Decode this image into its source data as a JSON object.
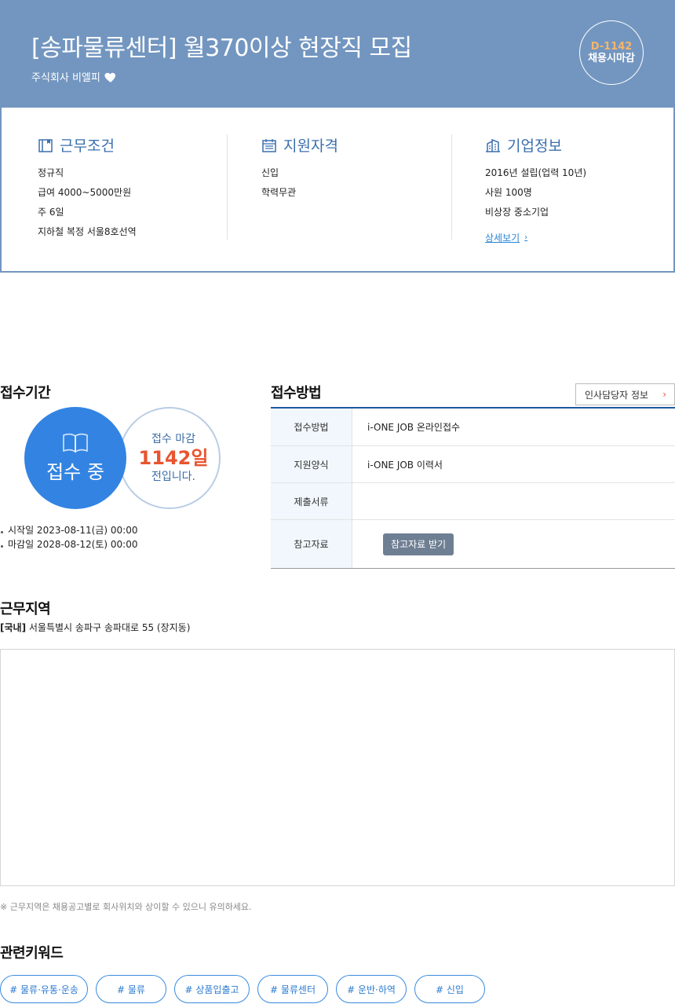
{
  "header": {
    "title": "[송파물류센터] 월370이상 현장직 모집",
    "company": "주식회사 비엘피",
    "dday": "D-1142",
    "deadline_text": "채용시마감"
  },
  "summary": {
    "work": {
      "title": "근무조건",
      "items": [
        "정규직",
        "급여 4000~5000만원",
        "주 6일",
        "지하철 복정 서울8호선역"
      ]
    },
    "qualification": {
      "title": "지원자격",
      "items": [
        "신입",
        "학력무관"
      ]
    },
    "company": {
      "title": "기업정보",
      "items": [
        "2016년 설립(업력 10년)",
        "사원 100명",
        "비상장 중소기업"
      ],
      "more": "상세보기"
    }
  },
  "period": {
    "title": "접수기간",
    "status": "접수 중",
    "deadline_label": "접수 마감",
    "days": "1142일",
    "suffix": "전입니다.",
    "start": "시작일 2023-08-11(금) 00:00",
    "end": "마감일 2028-08-12(토) 00:00"
  },
  "method": {
    "title": "접수방법",
    "contact_button": "인사담당자 정보",
    "rows": [
      {
        "label": "접수방법",
        "value": "i-ONE JOB 온라인접수"
      },
      {
        "label": "지원양식",
        "value": "i-ONE JOB 이력서"
      },
      {
        "label": "제출서류",
        "value": ""
      },
      {
        "label": "참고자료",
        "value": ""
      }
    ],
    "ref_button": "참고자료 받기"
  },
  "location": {
    "title": "근무지역",
    "region": "[국내]",
    "address": "서울특별시 송파구 송파대로 55 (장지동)",
    "note": "※ 근무지역은 채용공고별로 회사위치와 상이할 수 있으니 유의하세요."
  },
  "keywords": {
    "title": "관련키워드",
    "items": [
      "# 물류·유통·운송",
      "# 물류",
      "# 상품입출고",
      "# 물류센터",
      "# 운반·하역",
      "# 신입"
    ]
  },
  "colors": {
    "header_bg": "#7396c0",
    "accent_blue": "#3384e2",
    "accent_orange": "#e8542f",
    "dday_orange": "#f5b56a"
  }
}
